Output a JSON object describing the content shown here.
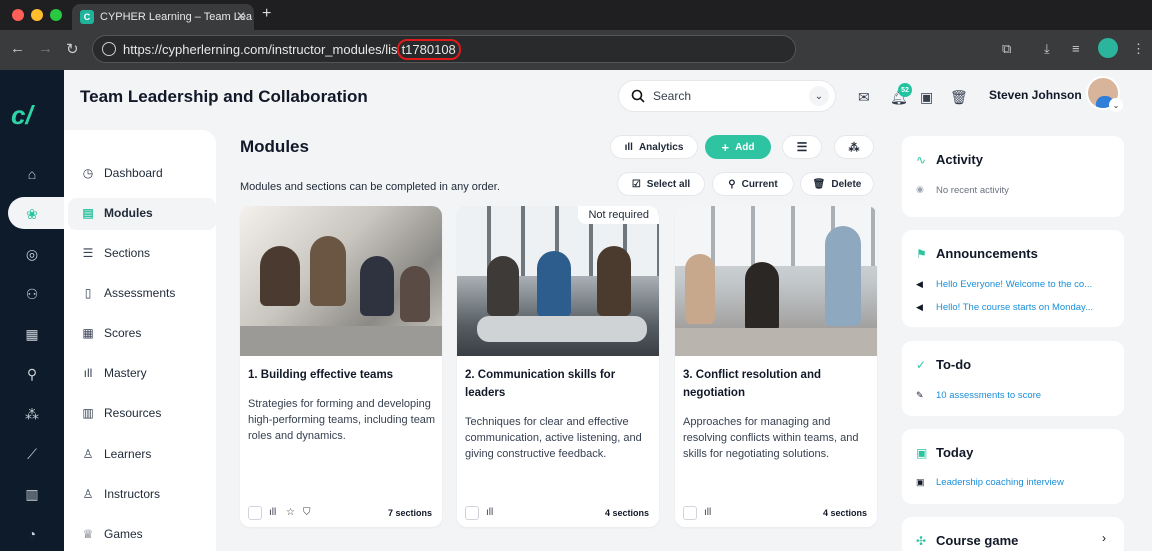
{
  "browser": {
    "tab_title": "CYPHER Learning – Team Lea",
    "url_main": "https://cypherlerning.com/instructor_modules/lis",
    "url_highlight": "t1780108"
  },
  "header": {
    "course_title": "Team Leadership and Collaboration",
    "search_placeholder": "Search",
    "notification_count": "52",
    "user_name": "Steven Johnson"
  },
  "subnav": {
    "items": [
      {
        "label": "Dashboard",
        "icon": "dashboard-icon"
      },
      {
        "label": "Modules",
        "icon": "modules-icon"
      },
      {
        "label": "Sections",
        "icon": "sections-icon"
      },
      {
        "label": "Assessments",
        "icon": "assessments-icon"
      },
      {
        "label": "Scores",
        "icon": "scores-icon"
      },
      {
        "label": "Mastery",
        "icon": "mastery-icon"
      },
      {
        "label": "Resources",
        "icon": "resources-icon"
      },
      {
        "label": "Learners",
        "icon": "learners-icon"
      },
      {
        "label": "Instructors",
        "icon": "instructors-icon"
      },
      {
        "label": "Games",
        "icon": "games-icon"
      }
    ]
  },
  "modules": {
    "heading": "Modules",
    "analytics_label": "Analytics",
    "add_label": "Add",
    "intro": "Modules and sections can be completed in any order.",
    "select_all_label": "Select all",
    "current_label": "Current",
    "delete_label": "Delete",
    "cards": [
      {
        "title": "1. Building effective teams",
        "description": "Strategies for forming and developing high-performing teams, including team roles and dynamics.",
        "sections": "7 sections"
      },
      {
        "title": "2. Communication skills for leaders",
        "description": "Techniques for clear and effective communication, active listening, and giving constructive feedback.",
        "sections": "4 sections",
        "tag": "Not required"
      },
      {
        "title": "3. Conflict resolution and negotiation",
        "description": "Approaches for managing and resolving conflicts within teams, and skills for negotiating solutions.",
        "sections": "4 sections"
      }
    ]
  },
  "sidebar": {
    "activity": {
      "title": "Activity",
      "line": "No recent activity"
    },
    "announcements": {
      "title": "Announcements",
      "lines": [
        "Hello Everyone! Welcome to the co...",
        "Hello! The course starts on Monday..."
      ]
    },
    "todo": {
      "title": "To-do",
      "line": "10 assessments to score"
    },
    "today": {
      "title": "Today",
      "line": "Leadership coaching interview"
    },
    "course_game": {
      "title": "Course game"
    }
  },
  "colors": {
    "accent": "#2ec4a1",
    "link": "#1a8fd8",
    "rail": "#0d1b2a",
    "highlight": "#e01a1a"
  }
}
